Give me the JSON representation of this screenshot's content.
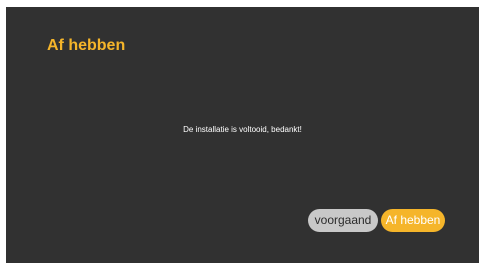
{
  "screen": {
    "title": "Af hebben",
    "message": "De installatie is voltooid, bedankt!"
  },
  "buttons": {
    "previous_label": "voorgaand",
    "finish_label": "Af hebben"
  },
  "colors": {
    "background": "#313131",
    "accent": "#f5b52a",
    "secondary_button": "#c8c8c8"
  }
}
